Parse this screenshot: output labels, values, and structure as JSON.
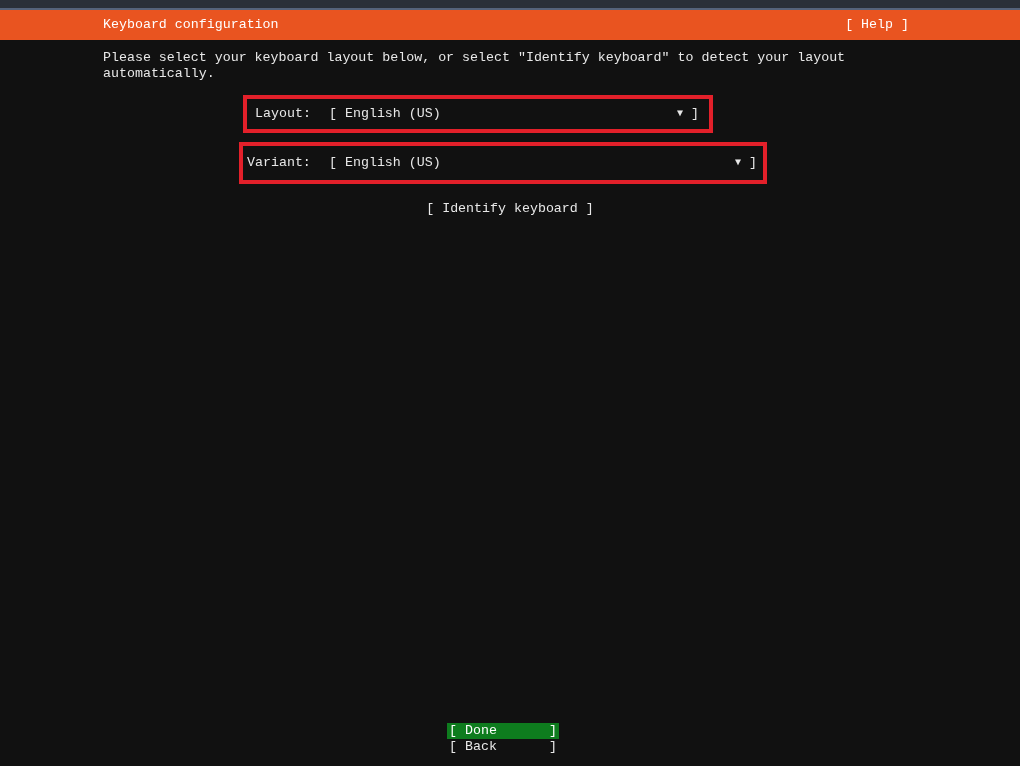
{
  "header": {
    "title": "Keyboard configuration",
    "help": "[ Help ]"
  },
  "intro": "Please select your keyboard layout below, or select \"Identify keyboard\" to detect your layout automatically.",
  "fields": [
    {
      "label": "Layout:",
      "value": "[ English (US)",
      "arrow": "▼",
      "close": "]",
      "highlighted": true
    },
    {
      "label": "Variant:",
      "value": "[ English (US)",
      "arrow": "▼",
      "close": "]",
      "highlighted": true
    }
  ],
  "identify": "[ Identify keyboard ]",
  "buttons": [
    {
      "label": "[ Done",
      "close": "]",
      "selected": true
    },
    {
      "label": "[ Back",
      "close": "]",
      "selected": false
    }
  ]
}
